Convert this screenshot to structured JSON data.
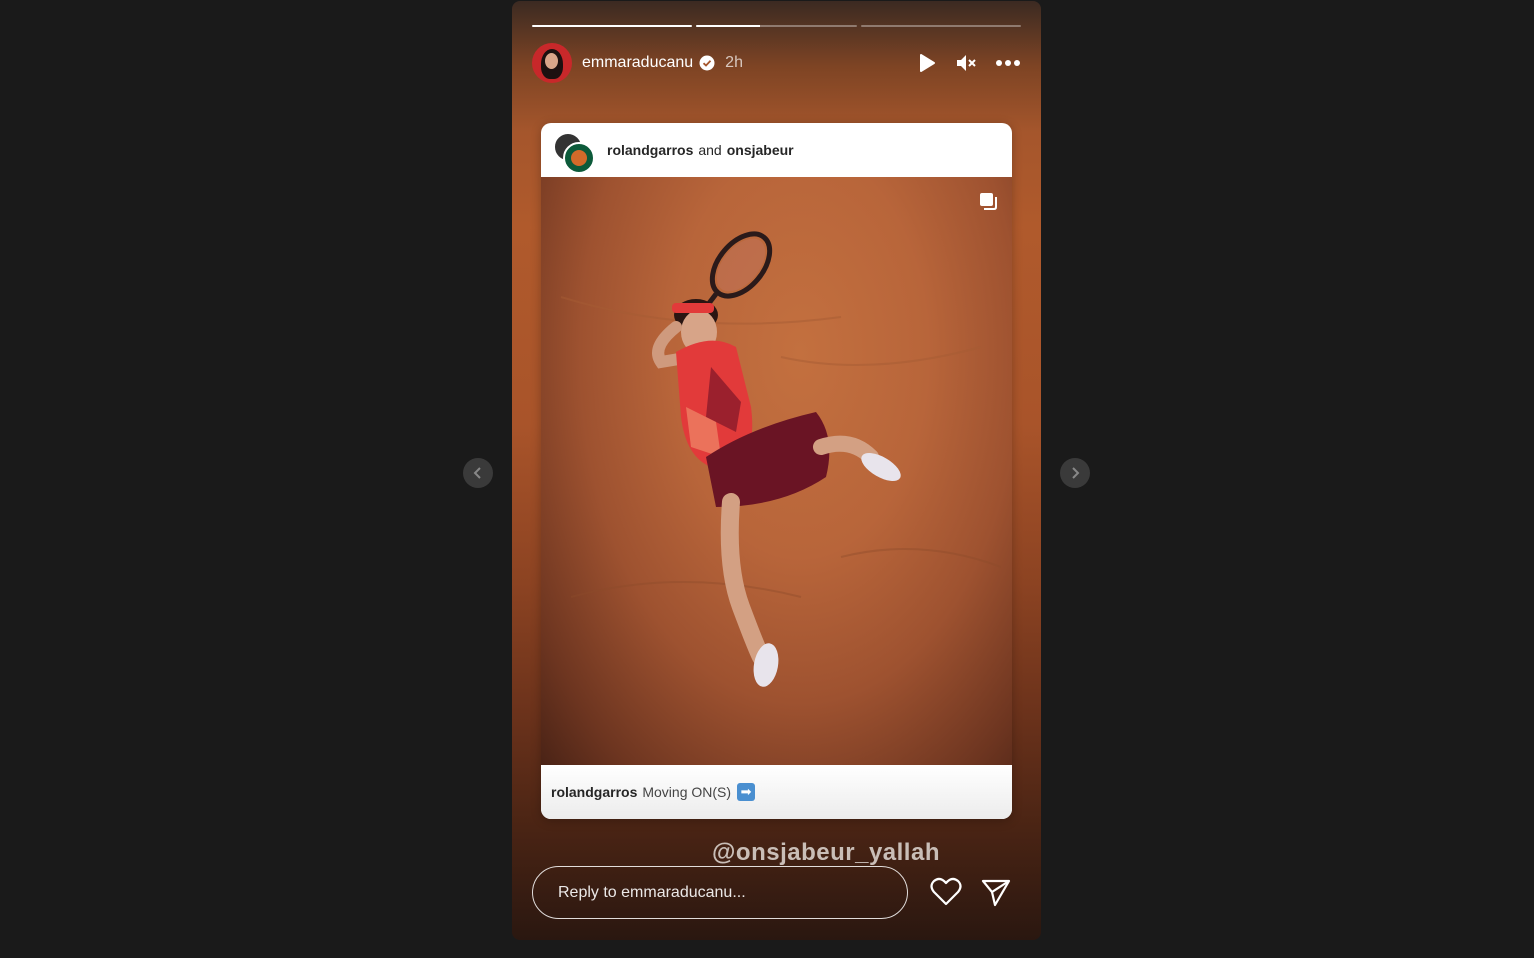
{
  "story": {
    "username": "emmaraducanu",
    "time": "2h",
    "progress": [
      1.0,
      0.4,
      0.0
    ]
  },
  "post": {
    "author1": "rolandgarros",
    "conjunction": "and",
    "author2": "onsjabeur",
    "caption_user": "rolandgarros",
    "caption_text": "Moving ON(S)",
    "caption_emoji": "➡"
  },
  "mention": "@onsjabeur_yallah",
  "reply": {
    "placeholder": "Reply to emmaraducanu..."
  },
  "icons": {
    "play": "play-icon",
    "mute": "mute-icon",
    "more": "more-icon",
    "like": "heart-icon",
    "share": "send-icon",
    "prev": "chevron-left-icon",
    "next": "chevron-right-icon"
  }
}
